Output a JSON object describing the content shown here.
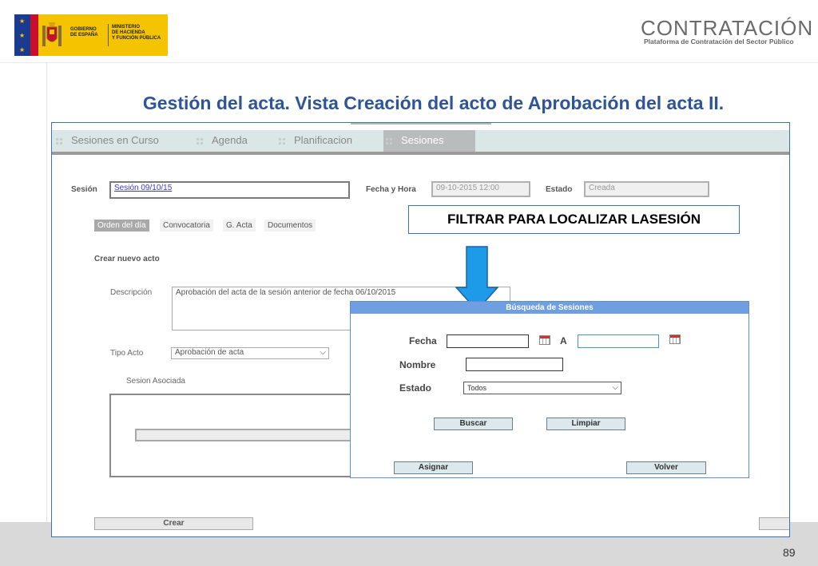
{
  "header": {
    "gov_logo_text": "GOBIERNO\nDE ESPAÑA",
    "ministry_text": "MINISTERIO\nDE HACIENDA\nY FUNCIÓN PÚBLICA",
    "brand_title": "CONTRATACIÓN",
    "brand_subtitle": "Plataforma de Contratación del Sector Público"
  },
  "slide": {
    "title": "Gestión del acta. Vista Creación del acto de Aprobación del acta II.",
    "page_number": "89",
    "callout": "FILTRAR PARA LOCALIZAR LASESIÓN"
  },
  "nav": {
    "items": [
      {
        "label": "Sesiones en Curso"
      },
      {
        "label": "Agenda"
      },
      {
        "label": "Planificacion"
      },
      {
        "label": "Sesiones"
      }
    ],
    "active": "Sesiones"
  },
  "form": {
    "sesion_label": "Sesión",
    "sesion_value": "Sesión 09/10/15",
    "fecha_label": "Fecha y Hora",
    "fecha_value": "09-10-2015 12:00",
    "estado_label": "Estado",
    "estado_value": "Creada",
    "subtabs": [
      "Orden del día",
      "Convocatoria",
      "G. Acta",
      "Documentos"
    ],
    "section_title": "Crear nuevo acto",
    "descripcion_label": "Descripción",
    "descripcion_value": "Aprobación del acta de la sesión anterior de fecha 06/10/2015",
    "tipo_label": "Tipo Acto",
    "tipo_value": "Aprobación de acta",
    "sesion_asociada_label": "Sesion Asociada",
    "crear_label": "Crear"
  },
  "modal": {
    "title": "Búsqueda de Sesiones",
    "fecha_label": "Fecha",
    "a_label": "A",
    "nombre_label": "Nombre",
    "estado_label": "Estado",
    "estado_value": "Todos",
    "buscar_label": "Buscar",
    "limpiar_label": "Limpiar",
    "asignar_label": "Asignar",
    "volver_label": "Volver"
  },
  "colors": {
    "title_blue": "#2e5596",
    "frame_border": "#3a73b8",
    "modal_header": "#6f9fe0",
    "arrow_fill": "#1e9be8"
  }
}
